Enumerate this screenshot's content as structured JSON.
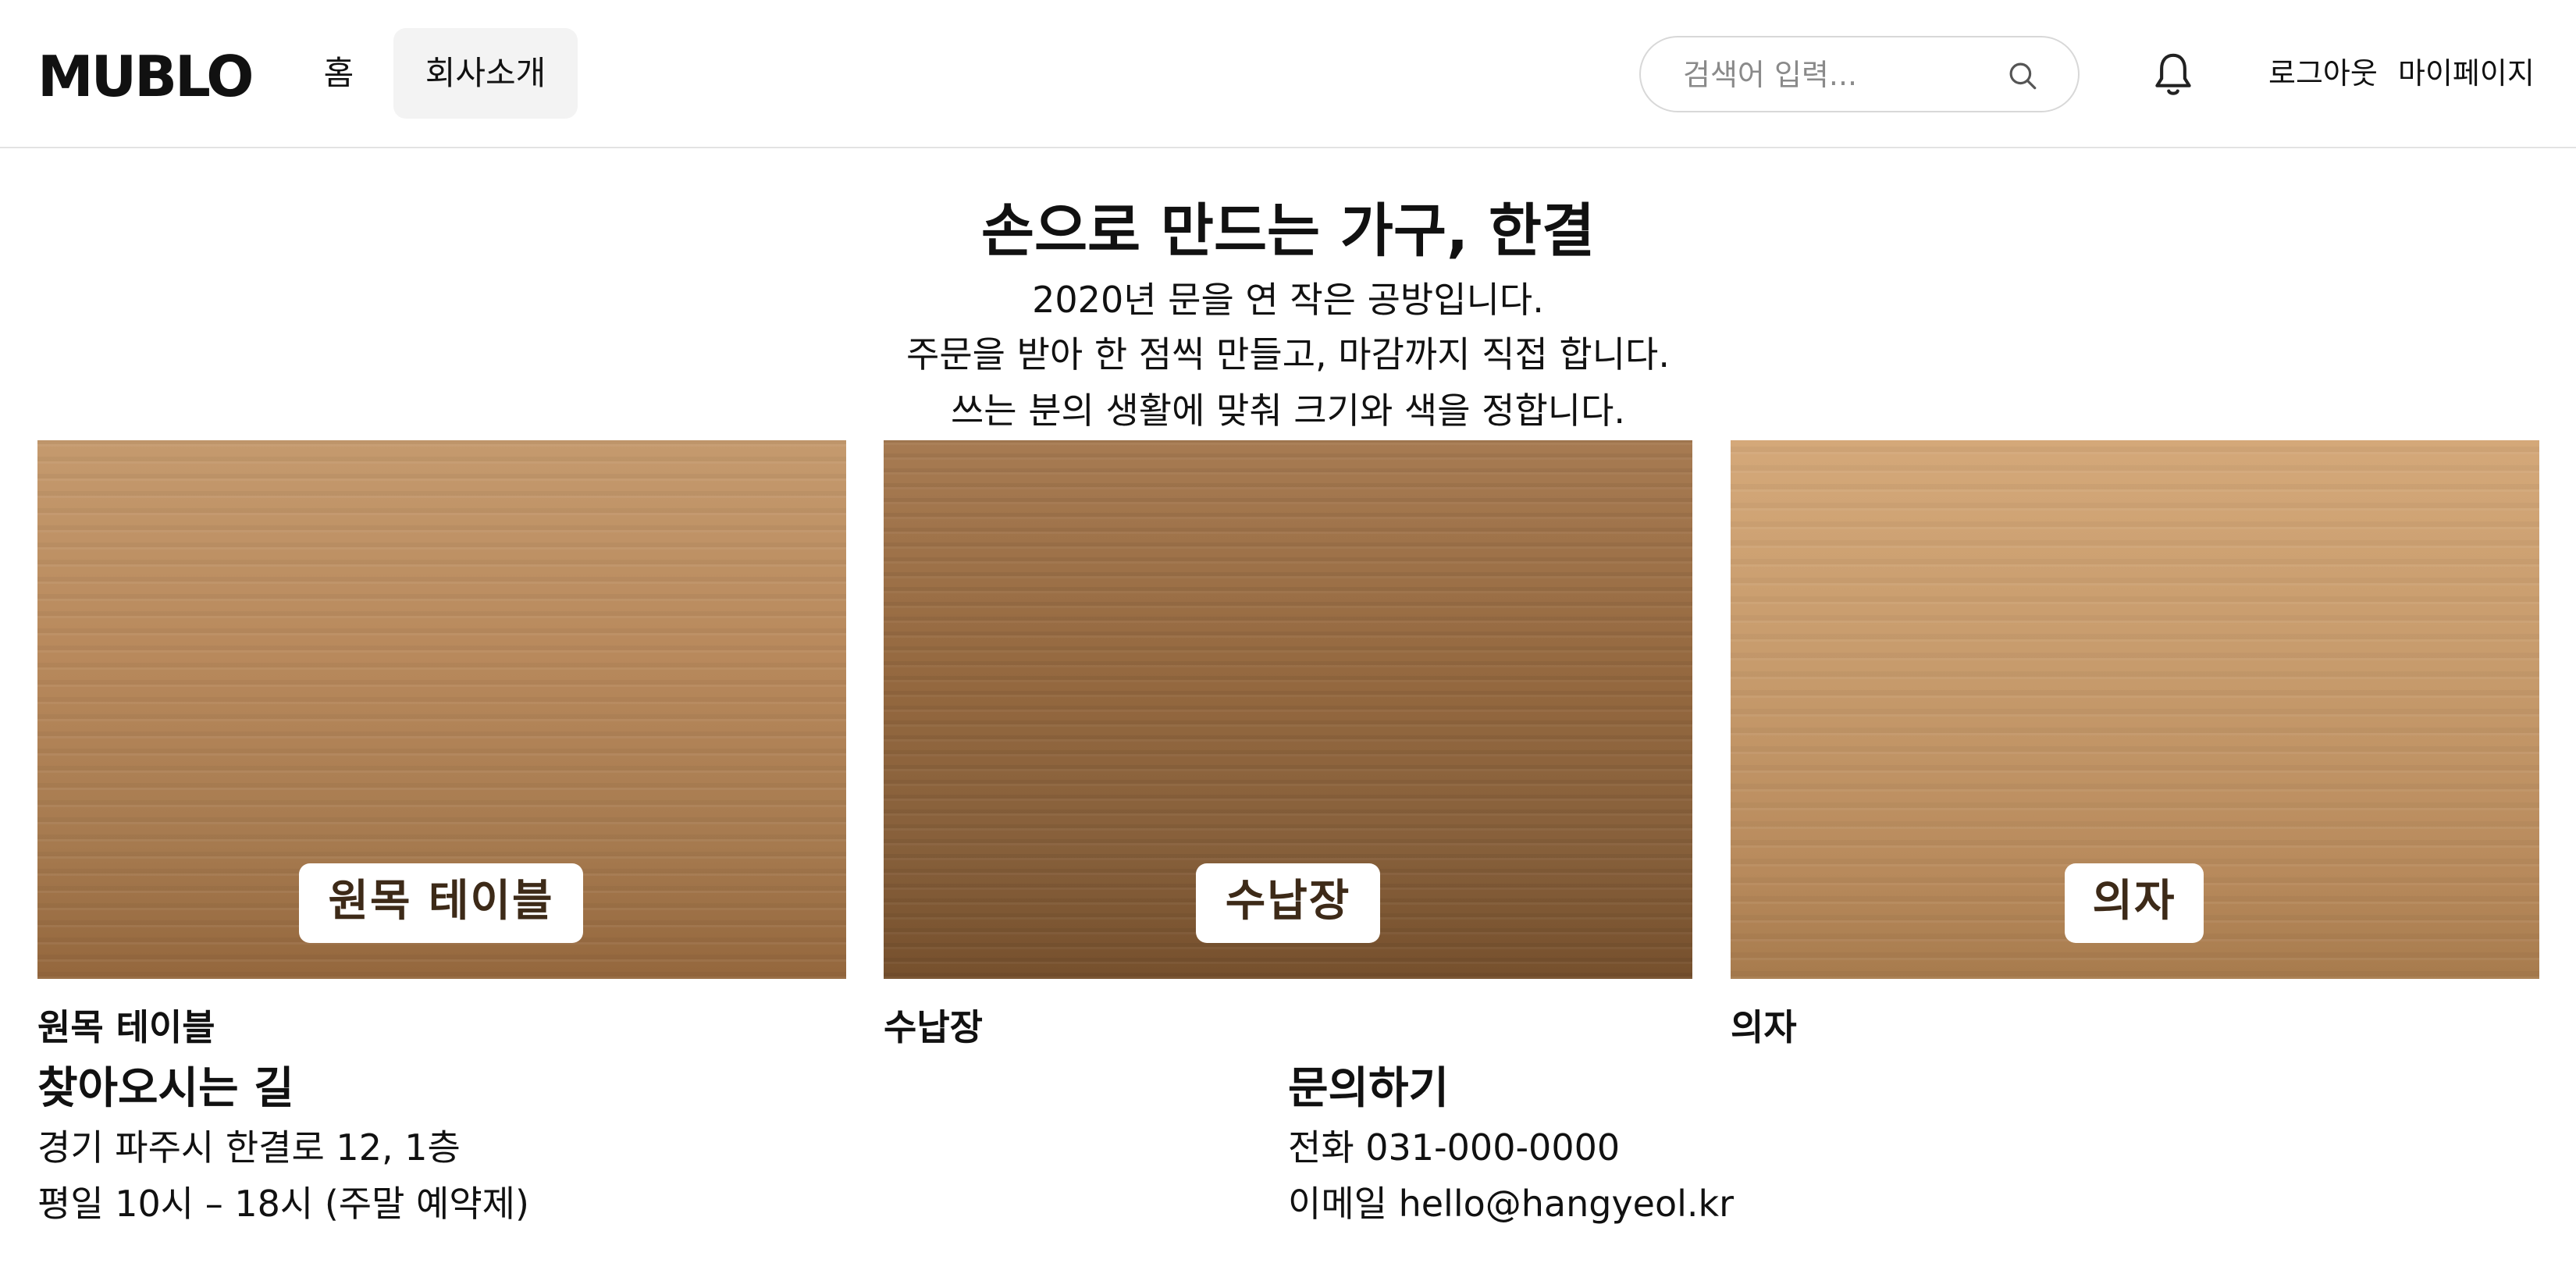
{
  "header": {
    "logo": "MUBLO",
    "nav": [
      {
        "label": "홈"
      },
      {
        "label": "회사소개"
      }
    ],
    "search": {
      "placeholder": "검색어 입력..."
    },
    "user_links": {
      "logout": "로그아웃",
      "mypage": "마이페이지"
    }
  },
  "hero": {
    "title": "손으로 만드는 가구, 한결",
    "lines": [
      "2020년 문을 연 작은 공방입니다.",
      "주문을 받아 한 점씩 만들고, 마감까지 직접 합니다.",
      "쓰는 분의 생활에 맞춰 크기와 색을 정합니다."
    ]
  },
  "products": [
    {
      "overlay": "원목 테이블",
      "label": "원목 테이블"
    },
    {
      "overlay": "수납장",
      "label": "수납장"
    },
    {
      "overlay": "의자",
      "label": "의자"
    }
  ],
  "directions": {
    "title": "찾아오시는 길",
    "address": "경기 파주시 한결로 12, 1층",
    "hours": "평일 10시 – 18시 (주말 예약제)"
  },
  "contact": {
    "title": "문의하기",
    "phone": "전화 031-000-0000",
    "email": "이메일 hello@hangyeol.kr"
  }
}
